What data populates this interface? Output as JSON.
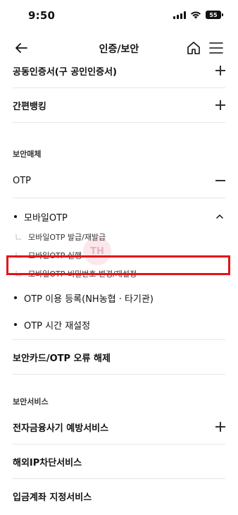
{
  "status": {
    "time": "9:50",
    "battery": "55"
  },
  "header": {
    "title": "인증/보안"
  },
  "menu": {
    "item_cert": "공동인증서(구 공인인증서)",
    "item_simple": "간편뱅킹",
    "section_security_media": "보안매체",
    "item_otp": "OTP",
    "sub_mobile_otp": "모바일OTP",
    "leaf_issue": "모바일OTP 발급/재발급",
    "leaf_run": "모바일OTP 실행",
    "leaf_pin": "모바일OTP 비밀번호 변경/재설정",
    "sub_otp_register": "OTP 이용 등록(NH농협 · 타기관)",
    "sub_otp_time": "OTP 시간 재설정",
    "item_card_release": "보안카드/OTP 오류 해제",
    "section_security_service": "보안서비스",
    "item_fraud": "전자금융사기 예방서비스",
    "item_ip": "해외IP차단서비스",
    "item_account": "입금계좌 지정서비스"
  },
  "highlight_color": "#e5121a",
  "watermark_text": "TH"
}
